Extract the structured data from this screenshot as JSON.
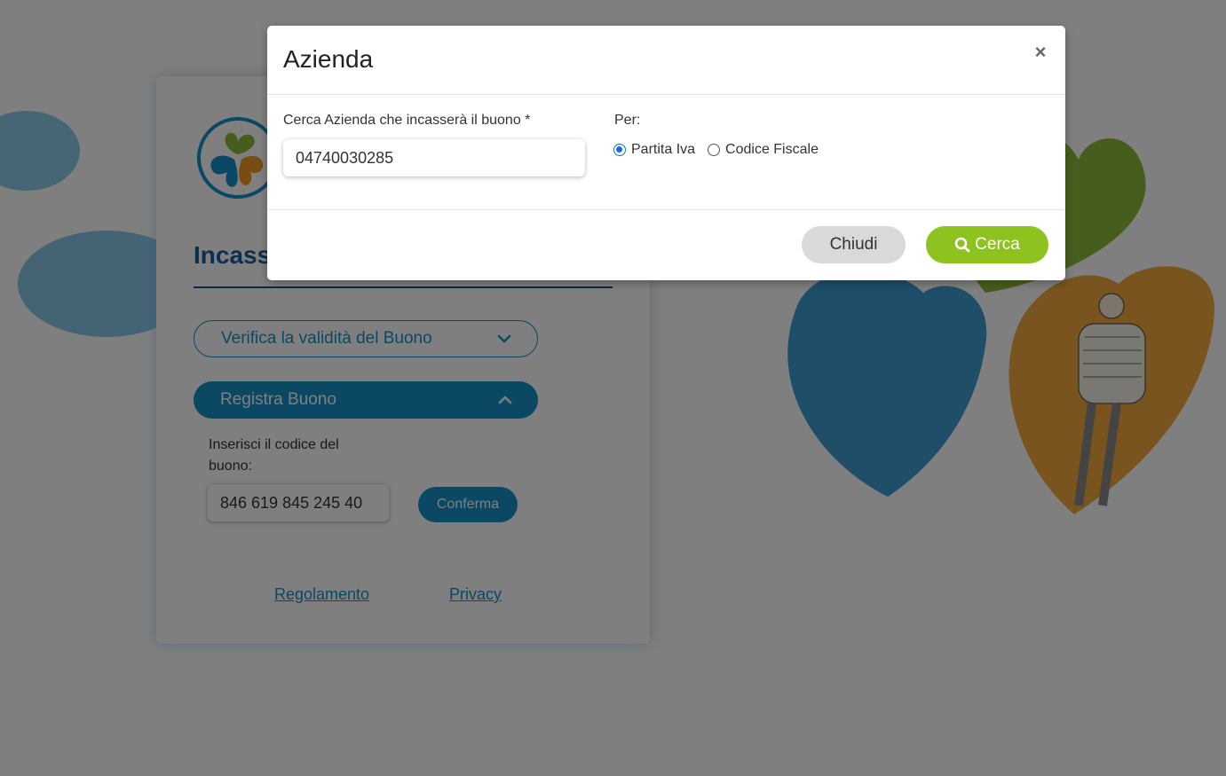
{
  "page": {
    "card_title": "Incass",
    "verify_accordion_label": "Verifica la validità del Buono",
    "register_accordion_label": "Registra Buono",
    "code_label": "Inserisci il codice del buono:",
    "code_value": "846 619 845 245 40",
    "confirm_label": "Conferma",
    "link_rules": "Regolamento",
    "link_privacy": "Privacy"
  },
  "modal": {
    "title": "Azienda",
    "close_symbol": "×",
    "search_label": "Cerca Azienda che incasserà il buono *",
    "search_value": "04740030285",
    "per_label": "Per:",
    "radio_options": [
      {
        "label": "Partita Iva",
        "checked": true
      },
      {
        "label": "Codice Fiscale",
        "checked": false
      }
    ],
    "close_button": "Chiudi",
    "search_button": "Cerca"
  },
  "colors": {
    "accent_blue": "#1591c8",
    "title_blue": "#1f5f9e",
    "green": "#8dc21f",
    "overlay": "rgba(0,0,0,0.5)"
  }
}
